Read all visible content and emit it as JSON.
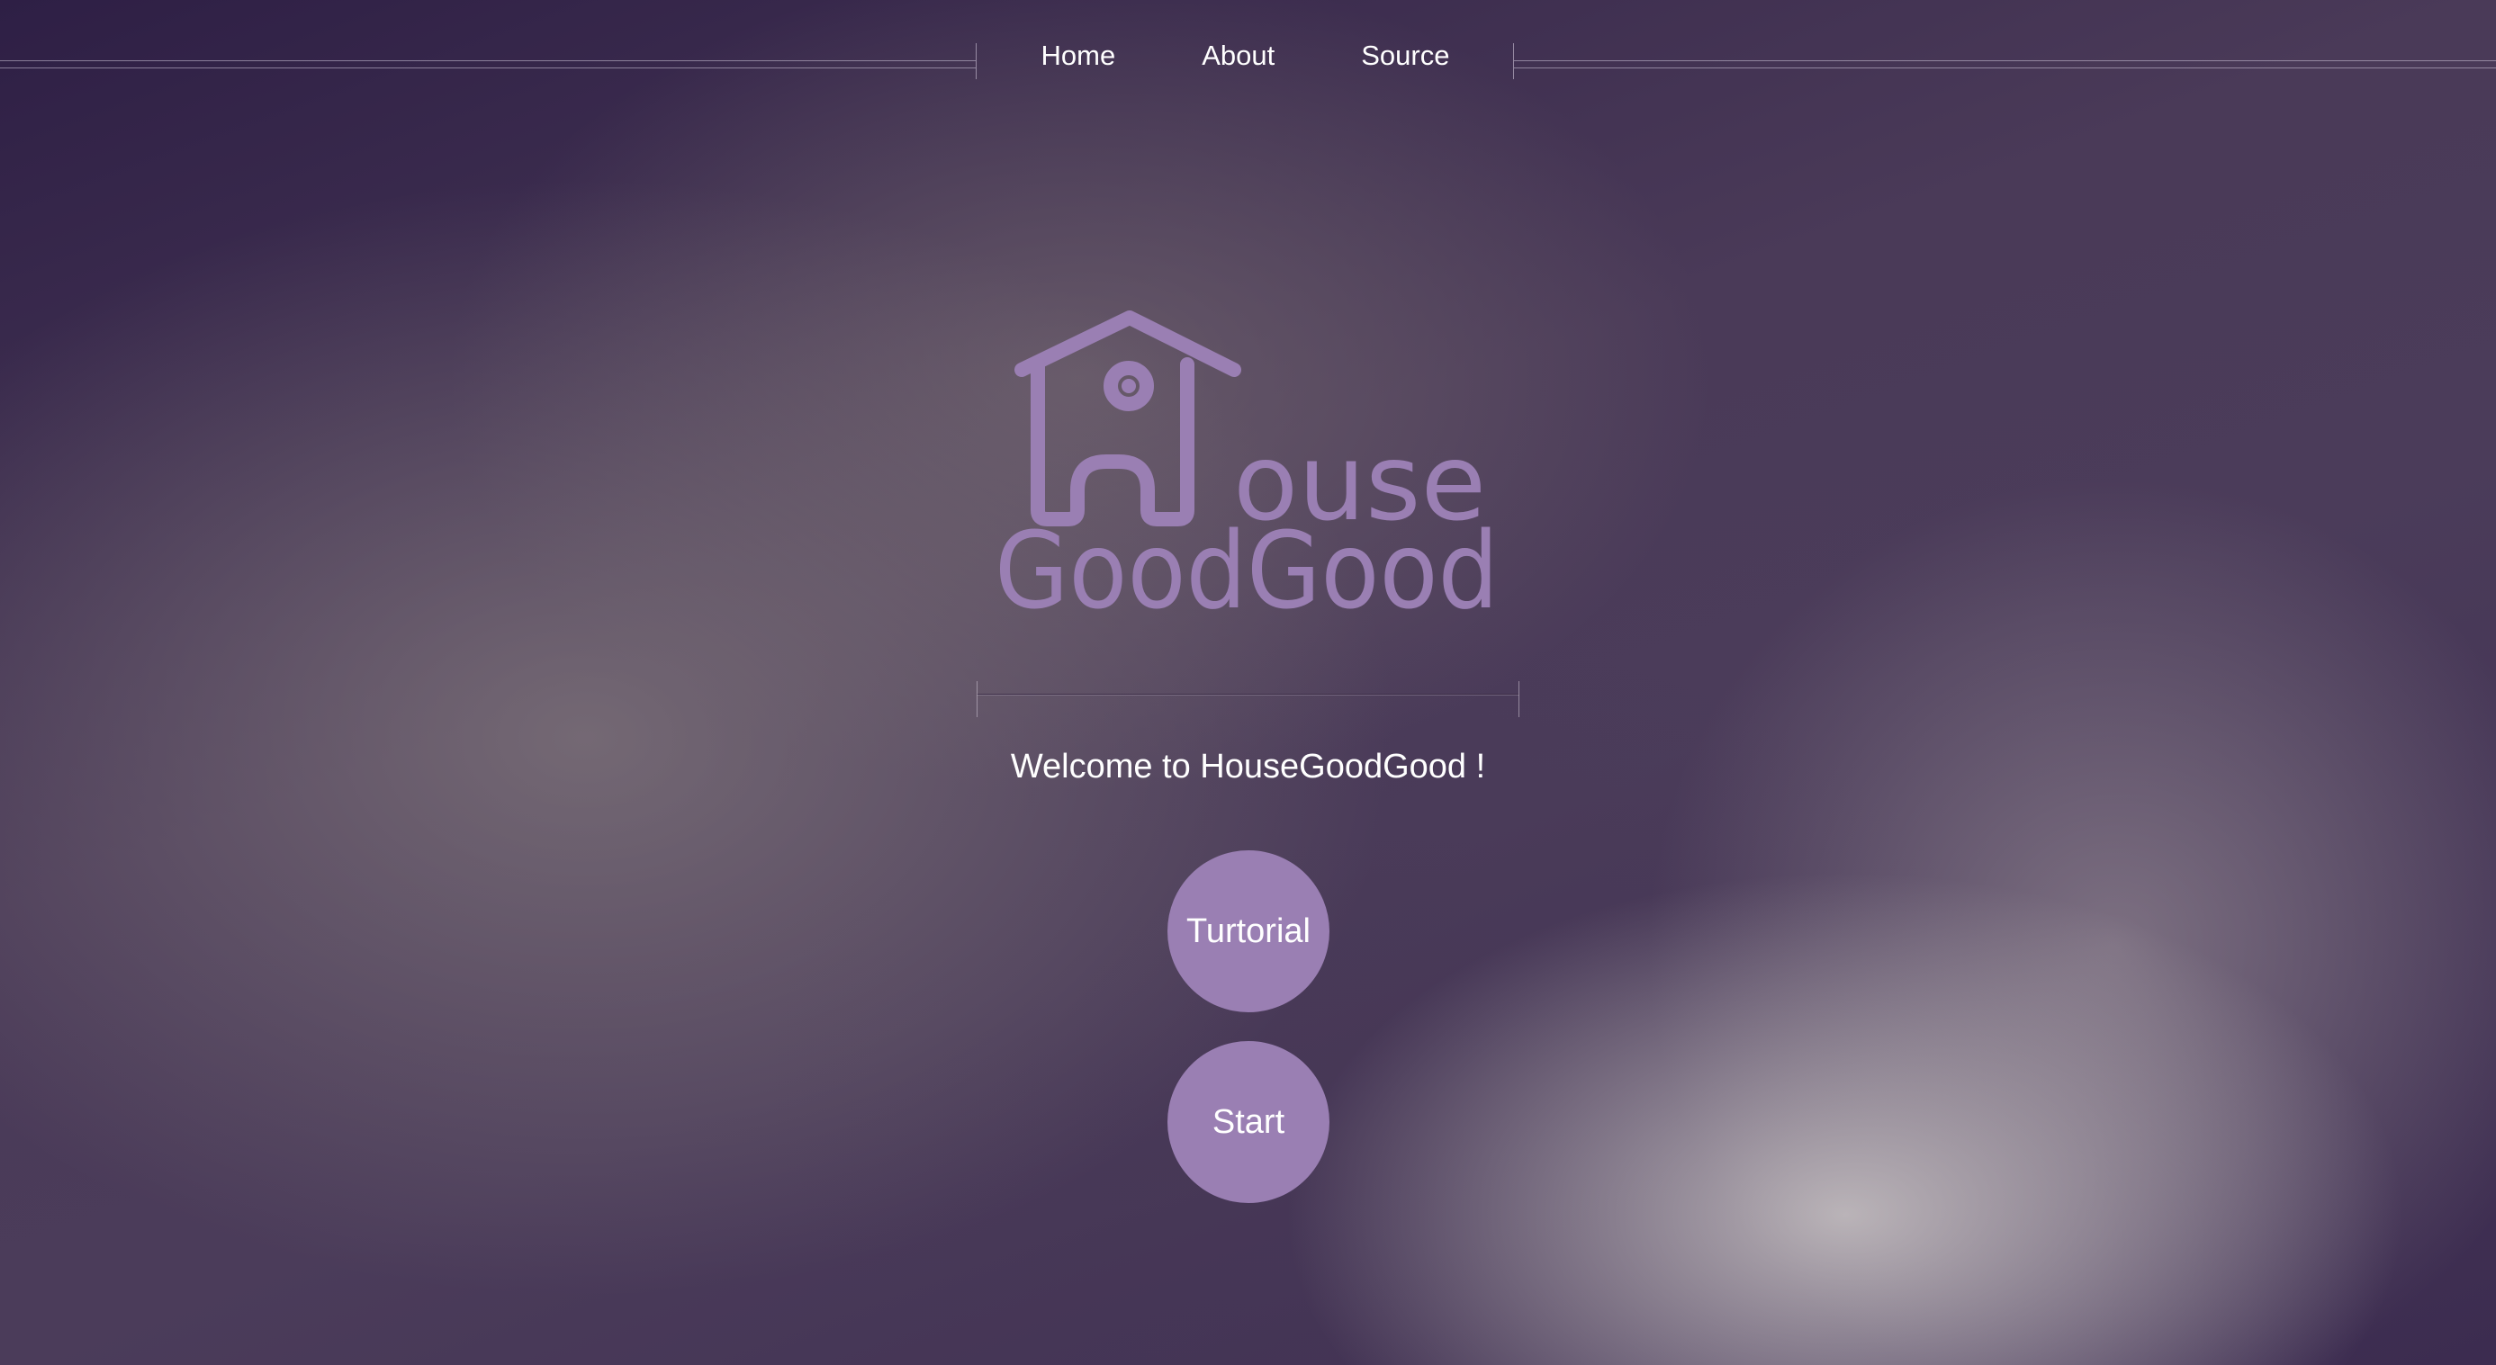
{
  "nav": {
    "items": [
      {
        "label": "Home"
      },
      {
        "label": "About"
      },
      {
        "label": "Source"
      }
    ]
  },
  "logo": {
    "line1": "ouse",
    "line2": "GoodGood",
    "color": "#9a7fb3",
    "icon": "house-icon"
  },
  "welcome": {
    "text": "Welcome to HouseGoodGood !"
  },
  "buttons": {
    "tutorial_label": "Turtorial",
    "start_label": "Start",
    "color": "#9a7fb3"
  }
}
